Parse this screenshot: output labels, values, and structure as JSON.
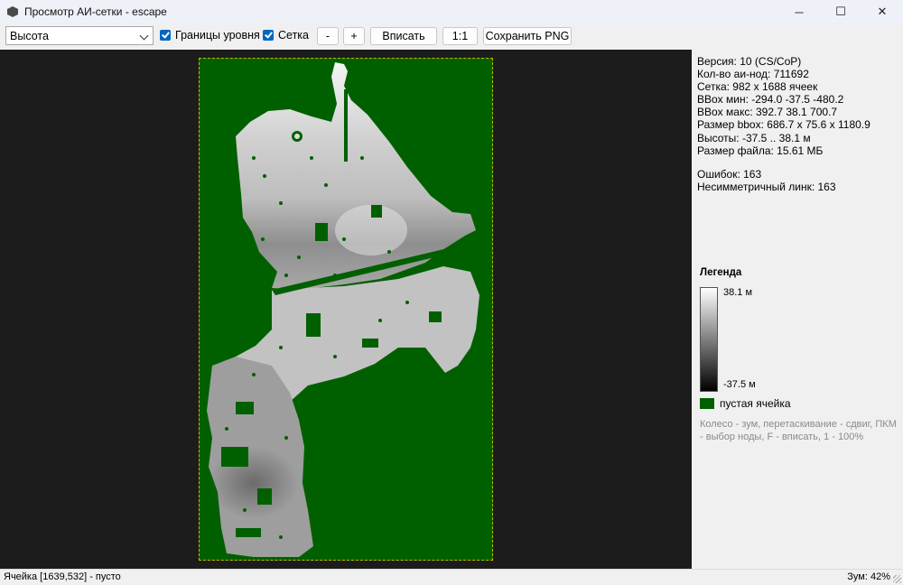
{
  "window": {
    "title": "Просмотр АИ-сетки - escape",
    "minimize": "─",
    "maximize": "☐",
    "close": "✕"
  },
  "toolbar": {
    "mode_select": "Высота",
    "level_bounds_label": "Границы уровня",
    "grid_label": "Сетка",
    "zoom_out_label": "-",
    "zoom_in_label": "+",
    "fit_label": "Вписать",
    "one_to_one_label": "1:1",
    "save_png_label": "Сохранить PNG"
  },
  "info": {
    "version": "Версия: 10 (CS/CoP)",
    "ai_nodes": "Кол-во аи-нод: 711692",
    "grid": "Сетка: 982 x 1688 ячеек",
    "bbox_min": "BBox мин: -294.0 -37.5 -480.2",
    "bbox_max": "BBox макс: 392.7 38.1 700.7",
    "bbox_size": "Размер bbox: 686.7 x 75.6 x 1180.9",
    "heights": "Высоты: -37.5 .. 38.1 м",
    "file_size": "Размер файла: 15.61 МБ",
    "errors": "Ошибок: 163",
    "asym_links": "Несимметричный линк:  163"
  },
  "legend": {
    "title": "Легенда",
    "max_label": "38.1 м",
    "min_label": "-37.5 м",
    "empty_cell_label": "пустая ячейка",
    "empty_color": "#006000",
    "help_text": "Колесо - зум, перетаскивание - сдвиг, ПКМ - выбор ноды, F - вписать, 1 - 100%"
  },
  "status": {
    "cell_info": "Ячейка [1639,532] - пусто",
    "zoom": "Зум: 42%"
  }
}
